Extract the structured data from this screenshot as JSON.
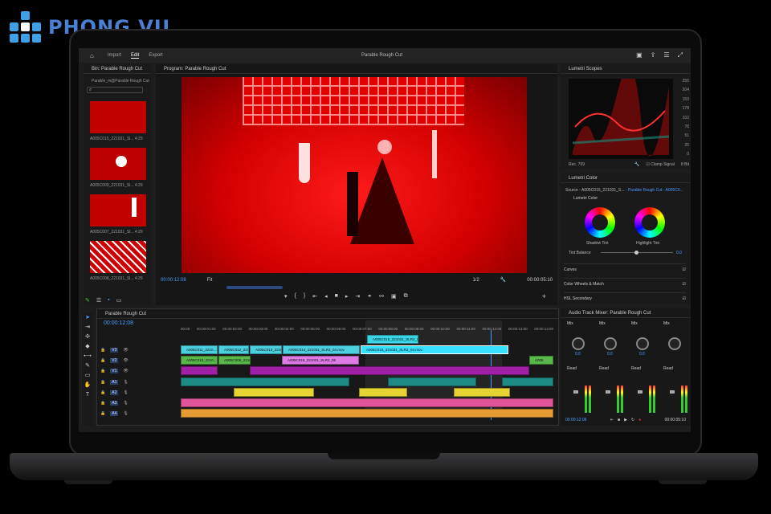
{
  "brand": {
    "logo_text": "PHONG VU",
    "color": "#4a7fd6"
  },
  "app": {
    "title": "Parable Rough Cut"
  },
  "workspaces": [
    {
      "label": "Import"
    },
    {
      "label": "Edit",
      "active": true
    },
    {
      "label": "Export"
    }
  ],
  "bin": {
    "title": "Bin: Parable Rough Cut",
    "path": "Parable_m@Parable Rough Cut",
    "items": [
      {
        "name": "A005C015_221031_Sl...",
        "duration": "4:29"
      },
      {
        "name": "A005C009_221031_Sl...",
        "duration": "4:29"
      },
      {
        "name": "A005C007_221031_Sl...",
        "duration": "4:29"
      },
      {
        "name": "A005C008_221031_Sl...",
        "duration": "4:29"
      }
    ]
  },
  "program": {
    "title": "Program: Parable Rough Cut",
    "timecode": "00:00:12:08",
    "fit": "Fit",
    "resolution": "1/2",
    "duration": "00:00:05:10"
  },
  "scopes": {
    "title": "Lumetri Scopes",
    "labels": [
      "255",
      "204",
      "153",
      "178",
      "102",
      "76",
      "51",
      "25",
      "0"
    ],
    "mode": "Rec. 709",
    "clamp": "Clamp Signal",
    "bits": "8 Bit"
  },
  "lumetri": {
    "title": "Lumetri Color",
    "source": "Source - A005C015_221031_S...",
    "target": "Parable Rough Cut - A005C0...",
    "section": "Lumetri Color",
    "shadow": "Shadow Tint",
    "highlight": "Highlight Tint",
    "tint_balance": "Tint Balance",
    "tint_value": "0.0",
    "sections": [
      {
        "label": "Curves"
      },
      {
        "label": "Color Wheels & Match"
      },
      {
        "label": "HSL Secondary"
      }
    ]
  },
  "timeline": {
    "title": "Parable Rough Cut",
    "timecode": "00:00:12:08",
    "ruler": [
      "00:00",
      "00:00:01:00",
      "00:00:02:00",
      "00:00:03:00",
      "00:00:04:00",
      "00:00:05:00",
      "00:00:06:00",
      "00:00:07:00",
      "00:00:08:00",
      "00:00:09:00",
      "00:00:10:00",
      "00:00:11:00",
      "00:00:12:00",
      "00:00:13:00",
      "00:00:14:00"
    ],
    "tracks": [
      "V3",
      "V2",
      "V1",
      "A1",
      "A2",
      "A3",
      "A4"
    ],
    "clips": {
      "v3": "A005C015_221031_SLR2_0...",
      "v2a": "A005C011_2210...",
      "v2b": "A005C012_2210...",
      "v2c": "A005C013_2210...",
      "v2d": "A005C014_221031_SLR2_04.mov",
      "v2e": "A005C016_221031_SLR2_04.mov",
      "v1a": "A005C010_2210...",
      "v1b": "A005C009_2210...",
      "v1c": "A005C015_221031_SLR2_08",
      "v1d": "A005"
    }
  },
  "mixer": {
    "title": "Audio Track Mixer: Parable Rough Cut",
    "channels": [
      {
        "mode": "Mix",
        "read": "Read",
        "val": "0.0"
      },
      {
        "mode": "Mix",
        "read": "Read",
        "val": "0.0"
      },
      {
        "mode": "Mix",
        "read": "Read",
        "val": "0.0"
      },
      {
        "mode": "Mix",
        "read": "Read",
        "val": ""
      }
    ],
    "timecode_left": "00:00:12:08",
    "timecode_right": "00:00:05:10"
  }
}
